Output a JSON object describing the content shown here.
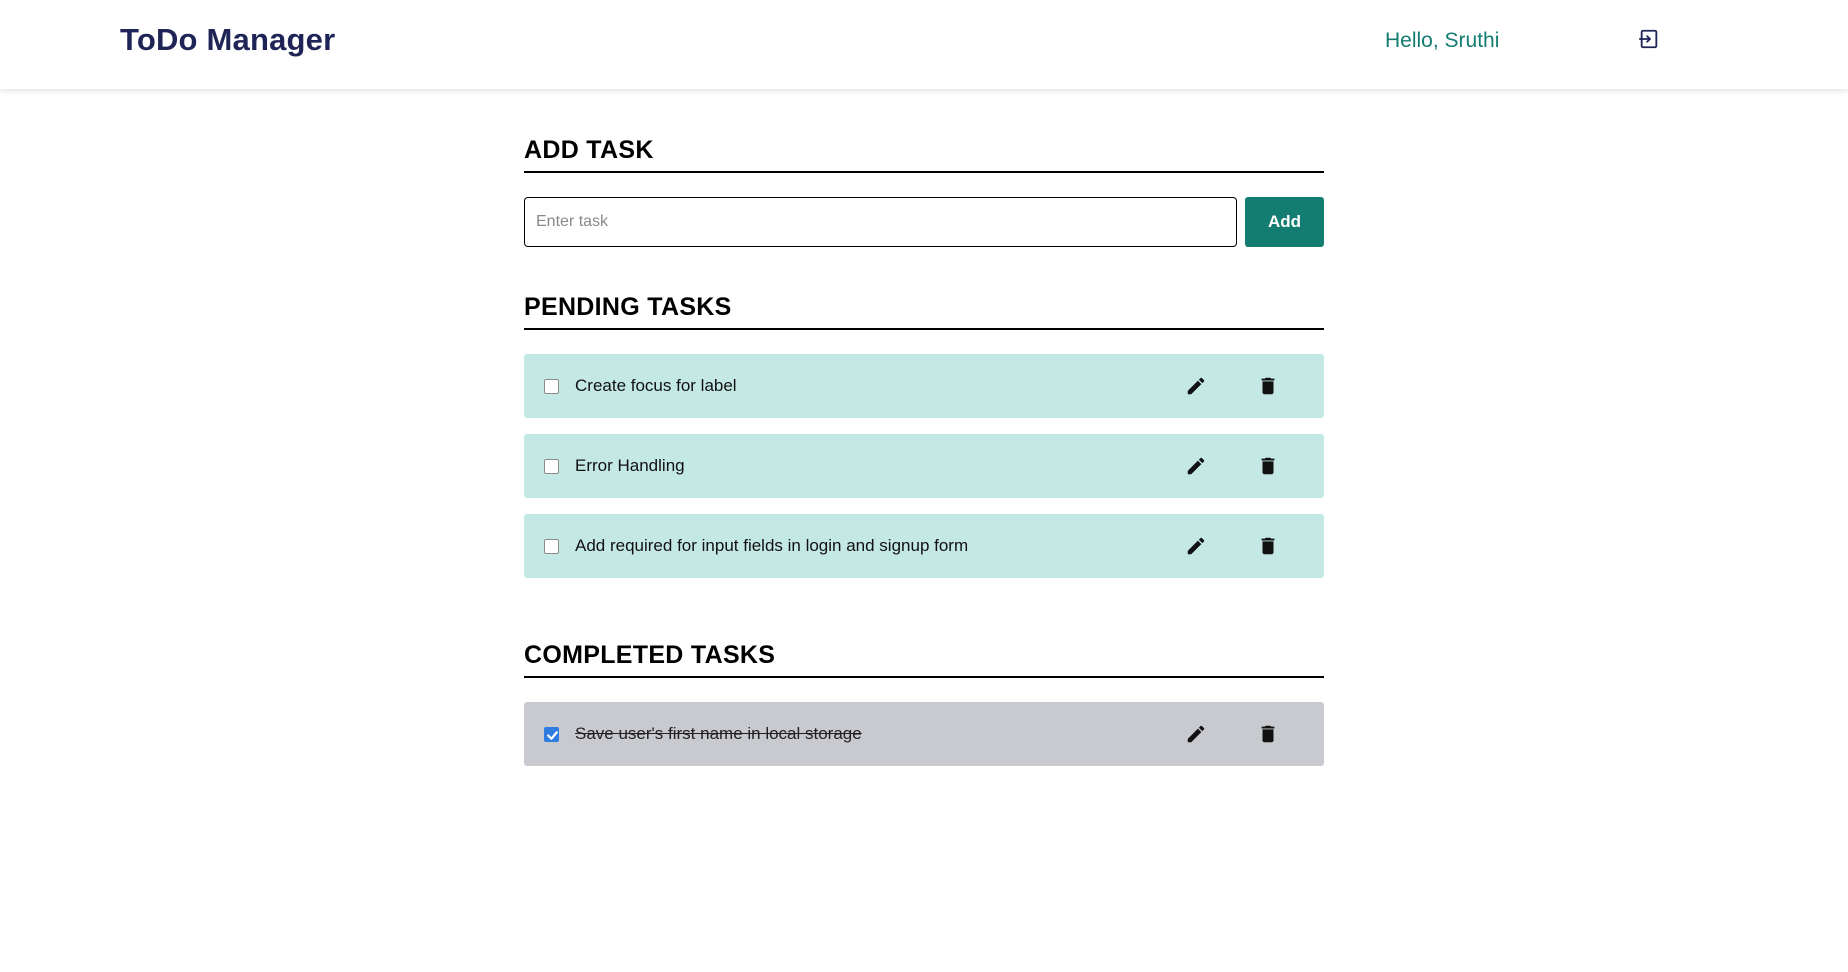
{
  "app": {
    "title": "ToDo Manager",
    "greeting": "Hello, Sruthi",
    "accent_color": "#127d70",
    "brand_color": "#1f2456"
  },
  "header": {
    "logout_icon": "logout-icon"
  },
  "add_task": {
    "heading": "ADD TASK",
    "placeholder": "Enter task",
    "value": "",
    "button_label": "Add"
  },
  "pending": {
    "heading": "PENDING TASKS",
    "color": "#c4e9e5",
    "tasks": [
      {
        "text": "Create focus for label",
        "checked": false
      },
      {
        "text": "Error Handling",
        "checked": false
      },
      {
        "text": "Add required for input fields in login and signup form",
        "checked": false
      }
    ]
  },
  "completed": {
    "heading": "COMPLETED TASKS",
    "color": "#c9cacf",
    "tasks": [
      {
        "text": "Save user's first name in local storage",
        "checked": true
      }
    ]
  }
}
